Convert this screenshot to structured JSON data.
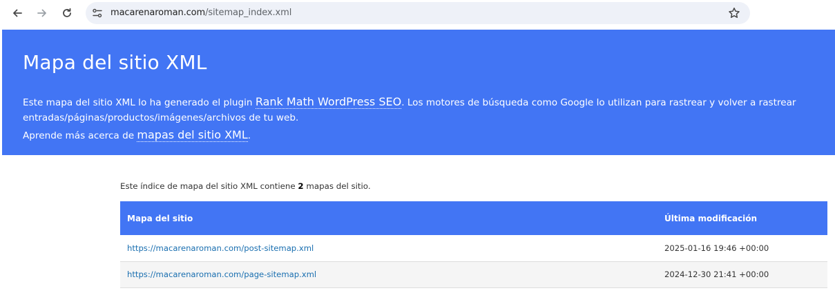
{
  "browser": {
    "url_host": "macarenaroman.com",
    "url_path": "/sitemap_index.xml"
  },
  "hero": {
    "title": "Mapa del sitio XML",
    "desc_before": "Este mapa del sitio XML lo ha generado el plugin ",
    "plugin_link": "Rank Math WordPress SEO",
    "desc_after": ". Los motores de búsqueda como Google lo utilizan para rastrear y volver a rastrear entradas/páginas/productos/imágenes/archivos de tu web.",
    "learn_before": "Aprende más acerca de ",
    "learn_link": "mapas del sitio XML",
    "learn_after": "."
  },
  "summary": {
    "before": "Este índice de mapa del sitio XML contiene ",
    "count": "2",
    "after": " mapas del sitio."
  },
  "table": {
    "headers": [
      "Mapa del sitio",
      "Última modificación"
    ],
    "rows": [
      {
        "url": "https://macarenaroman.com/post-sitemap.xml",
        "modified": "2025-01-16 19:46 +00:00"
      },
      {
        "url": "https://macarenaroman.com/page-sitemap.xml",
        "modified": "2024-12-30 21:41 +00:00"
      }
    ]
  },
  "colors": {
    "accent": "#4275f4",
    "link": "#1a6fb0",
    "omnibox_bg": "#eef1f8"
  },
  "icons": [
    "back-arrow-icon",
    "forward-arrow-icon",
    "reload-icon",
    "site-info-icon",
    "bookmark-star-icon"
  ]
}
